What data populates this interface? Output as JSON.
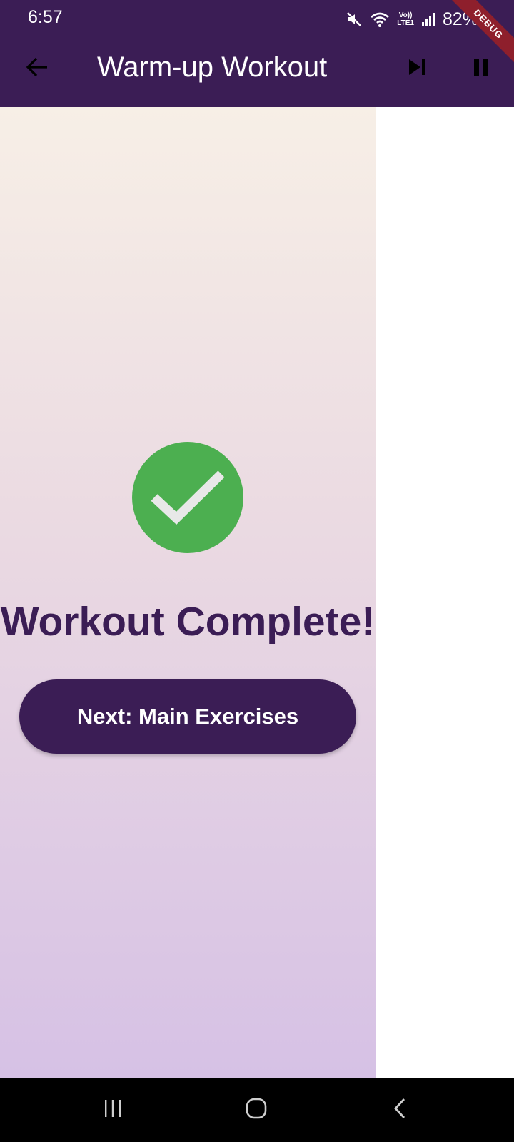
{
  "status_bar": {
    "time": "6:57",
    "lte_top": "Vo))",
    "lte_bottom": "LTE1",
    "battery": "82%",
    "icons": [
      "mute-icon",
      "wifi-icon",
      "lte-icon",
      "signal-icon",
      "battery-icon"
    ]
  },
  "debug_banner": "DEBUG",
  "app_bar": {
    "title": "Warm-up Workout",
    "back_icon": "arrow-back-icon",
    "skip_icon": "skip-next-icon",
    "pause_icon": "pause-icon"
  },
  "content": {
    "icon": "check-circle-icon",
    "title": "Workout Complete!",
    "button_label": "Next: Main Exercises"
  },
  "nav_bar": {
    "icons": [
      "recent-apps-icon",
      "home-icon",
      "back-icon"
    ]
  },
  "colors": {
    "primary": "#3b1d55",
    "success": "#4caf50",
    "gradient_top": "#f7efe6",
    "gradient_bottom": "#d6c1e5",
    "debug": "#8e1f2c"
  }
}
